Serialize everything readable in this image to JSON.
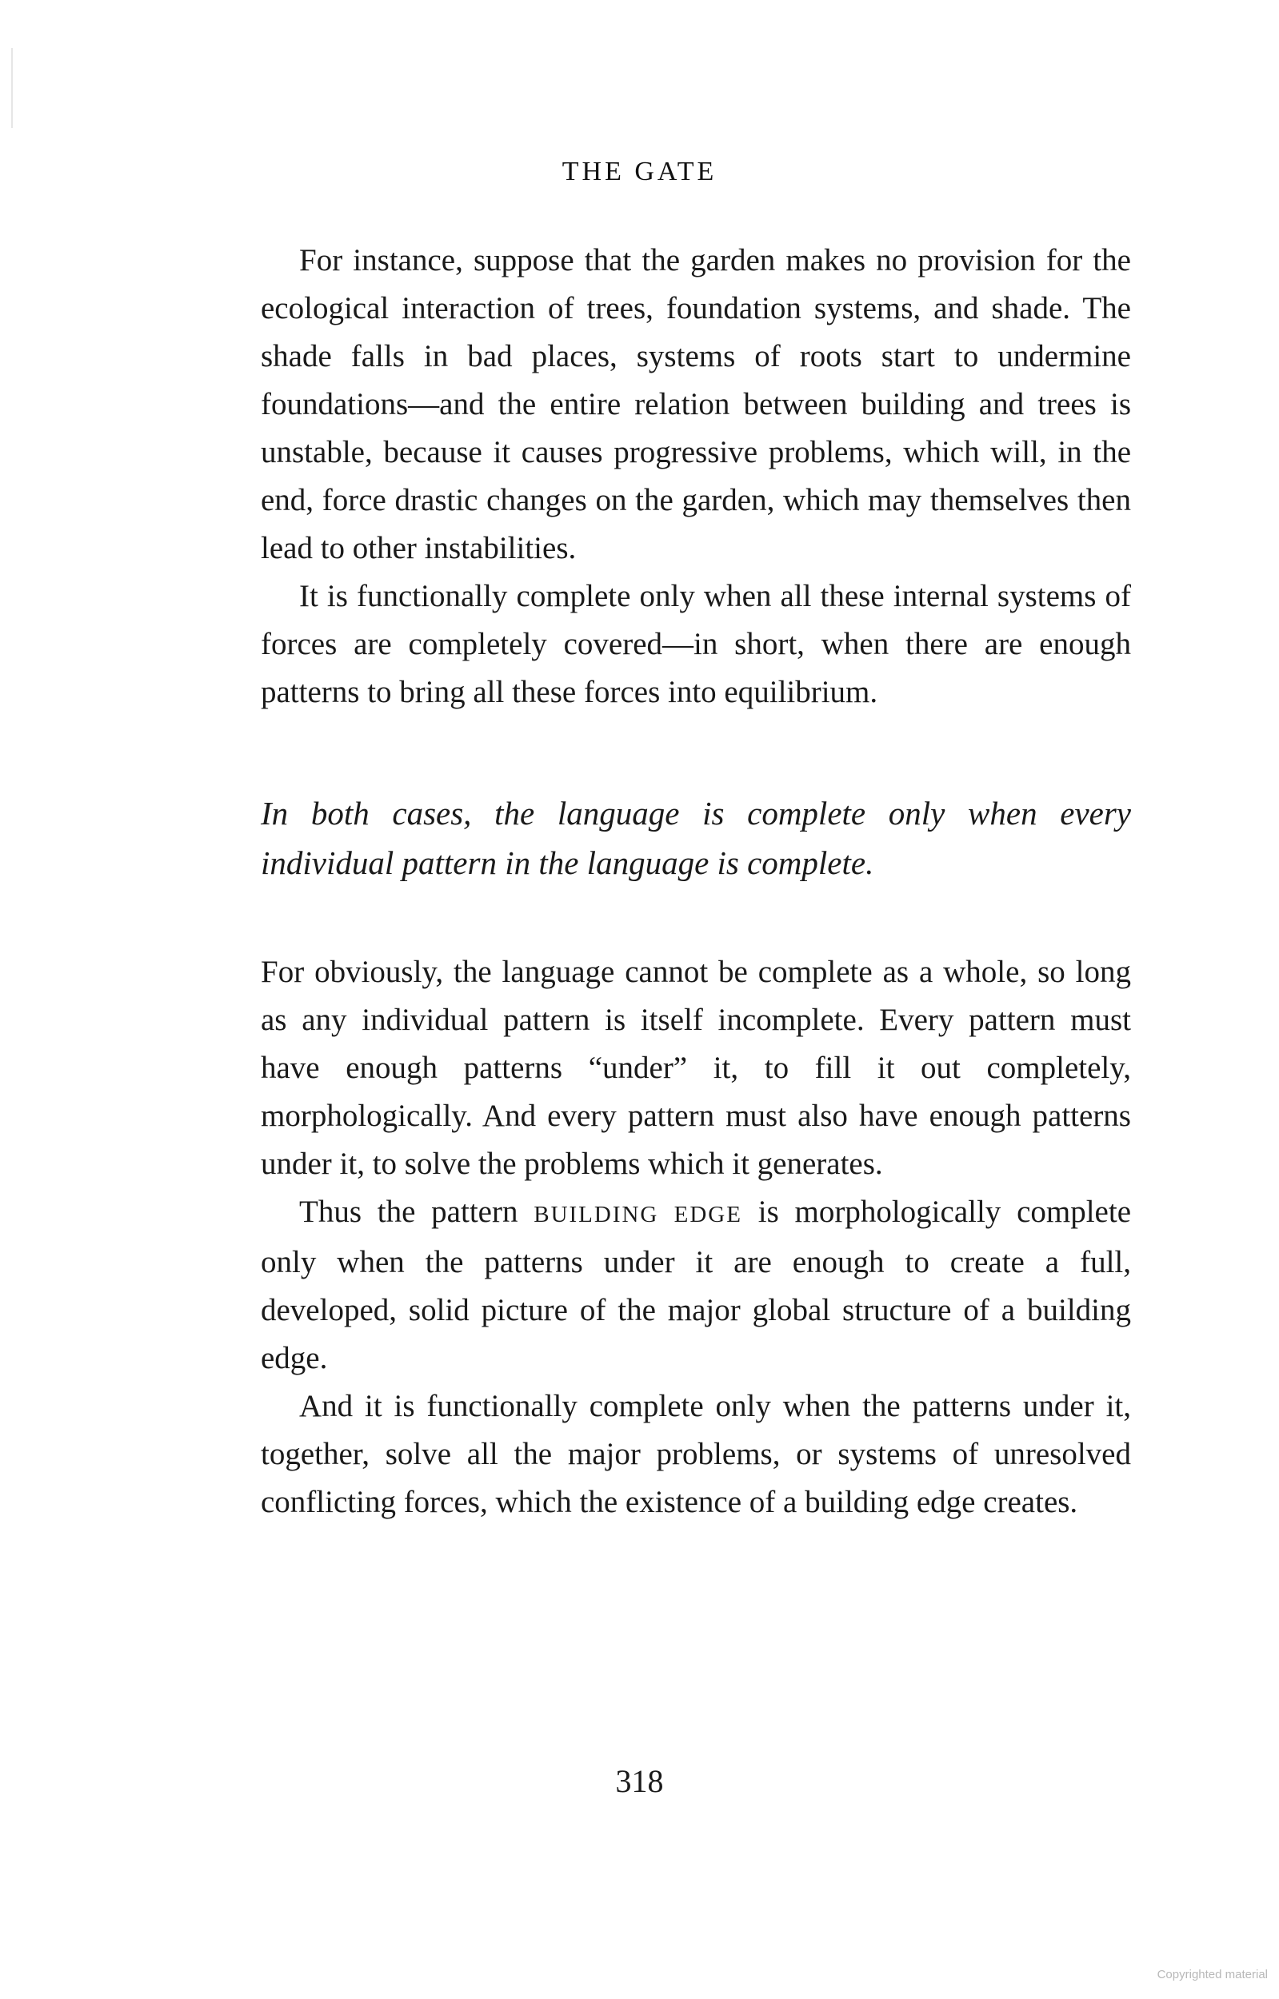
{
  "running_head": "THE GATE",
  "paragraphs": [
    {
      "text": "For instance, suppose that the garden makes no provision for the ecological interaction of trees, foundation systems, and shade. The shade falls in bad places, systems of roots start to undermine foundations—and the entire relation between building and trees is unstable, because it causes progressive problems, which will, in the end, force drastic changes on the garden, which may themselves then lead to other instabilities."
    },
    {
      "text": "It is functionally complete only when all these internal systems of forces are completely covered—in short, when there are enough patterns to bring all these forces into equilibrium."
    }
  ],
  "summary": "In both cases, the language is complete only when every individual pattern in the language is complete.",
  "paragraphs_after": [
    {
      "text": "For obviously, the language cannot be complete as a whole, so long as any individual pattern is itself incomplete. Every pattern must have enough patterns “under” it, to fill it out completely, morphologically. And every pattern must also have enough patterns under it, to solve the problems which it generates."
    },
    {
      "before": "Thus the pattern ",
      "smallcaps": "building edge",
      "after": " is morphologically complete only when the patterns under it are enough to create a full, developed, solid picture of the major global structure of a building edge."
    },
    {
      "text": "And it is functionally complete only when the patterns under it, together, solve all the major problems, or systems of unresolved conflicting forces, which the existence of a building edge creates."
    }
  ],
  "page_number": "318",
  "copyright_notice": "Copyrighted material"
}
